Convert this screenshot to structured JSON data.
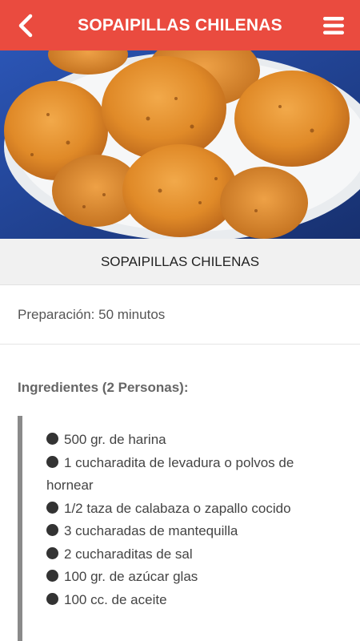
{
  "header": {
    "title": "SOPAIPILLAS CHILENAS",
    "back_icon": "chevron-left-icon",
    "menu_icon": "hamburger-menu-icon"
  },
  "hero": {
    "image": "photo of fried sopaipillas on a plate"
  },
  "recipe": {
    "title": "SOPAIPILLAS CHILENAS",
    "preparation": "Preparación: 50 minutos",
    "ingredients_heading": "Ingredientes (2 Personas):",
    "ingredients": [
      "500 gr. de harina",
      "1 cucharadita de levadura o polvos de hornear",
      "1/2 taza de calabaza o zapallo cocido",
      "3 cucharadas de mantequilla",
      "2 cucharaditas de sal",
      "100 gr. de azúcar glas",
      "100 cc. de aceite"
    ]
  },
  "colors": {
    "appbar": "#ea4b3f",
    "title_band": "#f1f1f1",
    "quote_bar": "#8a8a8a"
  }
}
